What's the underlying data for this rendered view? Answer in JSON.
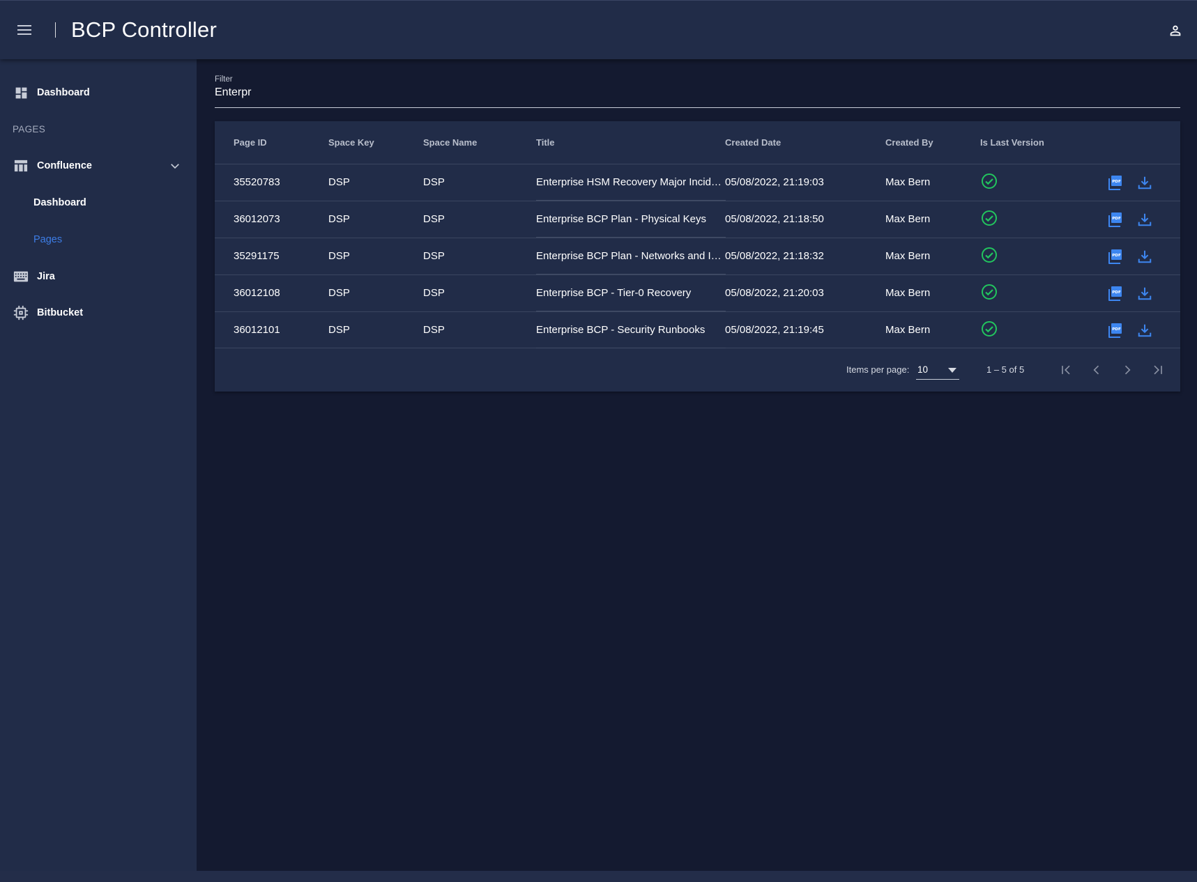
{
  "app": {
    "title": "BCP Controller"
  },
  "icons": {
    "menu": "menu-icon",
    "user": "account-icon",
    "dashboard": "dashboard-grid-icon",
    "confluence": "table-icon",
    "jira": "keyboard-icon",
    "bitbucket": "chip-icon",
    "expand": "chevron-down-icon",
    "last_version": "check-circle-icon",
    "pdf": "picture-as-pdf-icon",
    "download": "download-icon"
  },
  "colors": {
    "accent": "#3d7de6",
    "success": "#22c55e",
    "surface": "#212c48",
    "background": "#141a30"
  },
  "sidebar": {
    "dashboard": "Dashboard",
    "section_label": "PAGES",
    "confluence": "Confluence",
    "confluence_children": [
      "Dashboard",
      "Pages"
    ],
    "active_child": "Pages",
    "jira": "Jira",
    "bitbucket": "Bitbucket"
  },
  "filter": {
    "label": "Filter",
    "value": "Enterpr"
  },
  "table": {
    "columns": [
      "Page ID",
      "Space Key",
      "Space Name",
      "Title",
      "Created Date",
      "Created By",
      "Is Last Version"
    ],
    "rows": [
      [
        "35520783",
        "DSP",
        "DSP",
        "Enterprise HSM Recovery Major Incid…",
        "05/08/2022, 21:19:03",
        "Max Bern"
      ],
      [
        "36012073",
        "DSP",
        "DSP",
        "Enterprise BCP Plan - Physical Keys",
        "05/08/2022, 21:18:50",
        "Max Bern"
      ],
      [
        "35291175",
        "DSP",
        "DSP",
        "Enterprise BCP Plan - Networks and In…",
        "05/08/2022, 21:18:32",
        "Max Bern"
      ],
      [
        "36012108",
        "DSP",
        "DSP",
        "Enterprise BCP - Tier-0 Recovery",
        "05/08/2022, 21:20:03",
        "Max Bern"
      ],
      [
        "36012101",
        "DSP",
        "DSP",
        "Enterprise BCP - Security Runbooks",
        "05/08/2022, 21:19:45",
        "Max Bern"
      ]
    ]
  },
  "paginator": {
    "items_per_page_label": "Items per page:",
    "page_size": "10",
    "range": "1 – 5 of 5"
  }
}
